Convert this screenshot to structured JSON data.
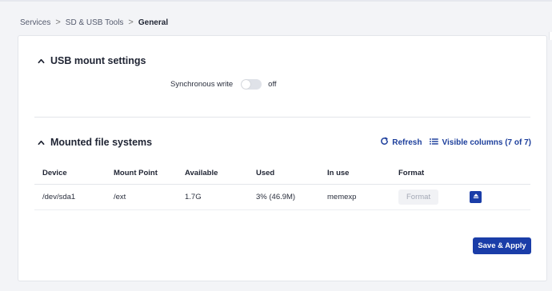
{
  "breadcrumb": {
    "items": [
      "Services",
      "SD & USB Tools"
    ],
    "current": "General",
    "separator": ">"
  },
  "usb_section": {
    "title": "USB mount settings",
    "sync_label": "Synchronous write",
    "sync_state": "off"
  },
  "mounted_section": {
    "title": "Mounted file systems",
    "refresh_label": "Refresh",
    "columns_label": "Visible columns (7 of 7)",
    "headers": {
      "device": "Device",
      "mount_point": "Mount Point",
      "available": "Available",
      "used": "Used",
      "in_use": "In use",
      "format": "Format"
    },
    "rows": [
      {
        "device": "/dev/sda1",
        "mount_point": "/ext",
        "available": "1.7G",
        "used": "3% (46.9M)",
        "in_use": "memexp",
        "format_label": "Format"
      }
    ]
  },
  "footer": {
    "save_label": "Save & Apply"
  },
  "colors": {
    "accent": "#1a3da8",
    "link": "#1d3f9c",
    "background": "#f3f4f7"
  },
  "icons": [
    "chevron-up-icon",
    "refresh-icon",
    "columns-icon",
    "eject-icon"
  ]
}
